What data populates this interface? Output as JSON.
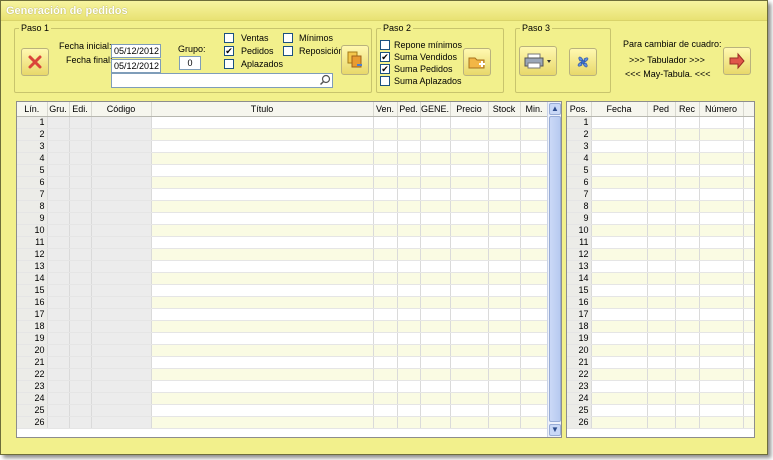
{
  "window": {
    "title": "Generación de pedidos"
  },
  "paso1": {
    "legend": "Paso 1",
    "fecha_inicial_label": "Fecha inicial:",
    "fecha_inicial": "05/12/2012",
    "fecha_final_label": "Fecha final:",
    "fecha_final": "05/12/2012",
    "grupo_label": "Grupo:",
    "grupo_value": "0",
    "checks": [
      {
        "label": "Ventas",
        "checked": false
      },
      {
        "label": "Pedidos",
        "checked": true
      },
      {
        "label": "Aplazados",
        "checked": false
      },
      {
        "label": "Mínimos",
        "checked": false
      },
      {
        "label": "Reposición",
        "checked": false
      }
    ],
    "search_value": ""
  },
  "paso2": {
    "legend": "Paso 2",
    "checks": [
      {
        "label": "Repone mínimos",
        "checked": false
      },
      {
        "label": "Suma Vendidos",
        "checked": true
      },
      {
        "label": "Suma Pedidos",
        "checked": true
      },
      {
        "label": "Suma Aplazados",
        "checked": false
      }
    ]
  },
  "paso3": {
    "legend": "Paso 3"
  },
  "info": {
    "line1": "Para cambiar de cuadro:",
    "line2": ">>> Tabulador >>>",
    "line3": "<<< May-Tabula. <<<"
  },
  "left_grid": {
    "columns": [
      "Lín.",
      "Gru.",
      "Edi.",
      "Código",
      "Título",
      "Ven.",
      "Ped.",
      "GENE.",
      "Precio",
      "Stock",
      "Min."
    ],
    "rows": [
      "1",
      "2",
      "3",
      "4",
      "5",
      "6",
      "7",
      "8",
      "9",
      "10",
      "11",
      "12",
      "13",
      "14",
      "15",
      "16",
      "17",
      "18",
      "19",
      "20",
      "21",
      "22",
      "23",
      "24",
      "25",
      "26"
    ]
  },
  "right_grid": {
    "columns": [
      "Pos.",
      "Fecha",
      "Ped",
      "Rec",
      "Número"
    ],
    "rows": [
      "1",
      "2",
      "3",
      "4",
      "5",
      "6",
      "7",
      "8",
      "9",
      "10",
      "11",
      "12",
      "13",
      "14",
      "15",
      "16",
      "17",
      "18",
      "19",
      "20",
      "21",
      "22",
      "23",
      "24",
      "25",
      "26"
    ]
  },
  "scrollbar": {
    "up": "▲",
    "down": "▼"
  },
  "colors": {
    "window_bg": "#f2f08c",
    "row_alt": "#fafbe3",
    "accent_red": "#e0554a"
  }
}
